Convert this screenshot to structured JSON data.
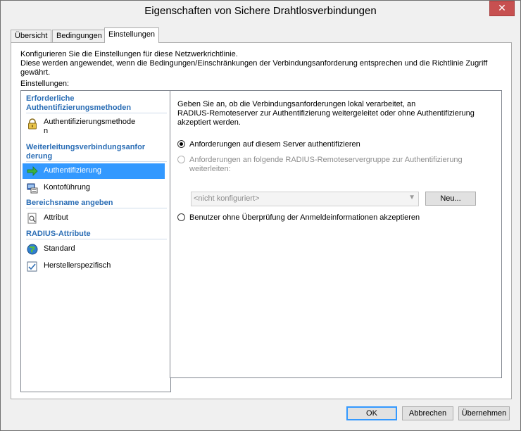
{
  "window": {
    "title": "Eigenschaften von Sichere Drahtlosverbindungen",
    "close_icon": "close-icon"
  },
  "tabs": [
    {
      "label": "Übersicht",
      "active": false
    },
    {
      "label": "Bedingungen",
      "active": false
    },
    {
      "label": "Einstellungen",
      "active": true
    }
  ],
  "panel": {
    "description_line1": "Konfigurieren Sie die Einstellungen für diese Netzwerkrichtlinie.",
    "description_line2": "Diese werden angewendet, wenn die Bedingungen/Einschränkungen der Verbindungsanforderung entsprechen und die Richtlinie Zugriff gewährt.",
    "settings_label": "Einstellungen:"
  },
  "left_pane": {
    "categories": [
      {
        "label_line1": "Erforderliche",
        "label_line2": "Authentifizierungsmethoden"
      },
      {
        "label_line1": "Weiterleitungsverbindungsanfor",
        "label_line2": "derung"
      },
      {
        "label_line1": "Bereichsname angeben"
      },
      {
        "label_line1": "RADIUS-Attribute"
      }
    ],
    "items": [
      {
        "label_line1": "Authentifizierungsmethode",
        "label_line2": "n",
        "icon": "lock-icon",
        "selected": false
      },
      {
        "label_line1": "Authentifizierung",
        "icon": "green-arrow-icon",
        "selected": true
      },
      {
        "label_line1": "Kontoführung",
        "icon": "accounting-icon",
        "selected": false
      },
      {
        "label_line1": "Attribut",
        "icon": "attribute-icon",
        "selected": false
      },
      {
        "label_line1": "Standard",
        "icon": "globe-icon",
        "selected": false
      },
      {
        "label_line1": "Herstellerspezifisch",
        "icon": "checklist-icon",
        "selected": false
      }
    ]
  },
  "right_pane": {
    "description_line1": "Geben Sie an, ob die Verbindungsanforderungen lokal verarbeitet, an",
    "description_line2": "RADIUS-Remoteserver zur Authentifizierung weitergeleitet oder ohne Authentifizierung",
    "description_line3": "akzeptiert werden.",
    "options": [
      {
        "label_line1": "Anforderungen auf diesem Server authentifizieren",
        "checked": true,
        "enabled": true
      },
      {
        "label_line1": "Anforderungen an folgende RADIUS-Remoteservergruppe zur Authentifizierung",
        "label_line2": "weiterleiten:",
        "checked": false,
        "enabled": false
      },
      {
        "label_line1": "Benutzer ohne Überprüfung der Anmeldeinformationen akzeptieren",
        "checked": false,
        "enabled": true
      }
    ],
    "server_group_select": {
      "value": "<nicht konfiguriert>",
      "enabled": false
    },
    "new_button": "Neu..."
  },
  "footer": {
    "ok": "OK",
    "cancel": "Abbrechen",
    "apply": "Übernehmen"
  },
  "colors": {
    "selection": "#3399ff",
    "category_text": "#2a6db5",
    "close_button": "#c75050"
  }
}
